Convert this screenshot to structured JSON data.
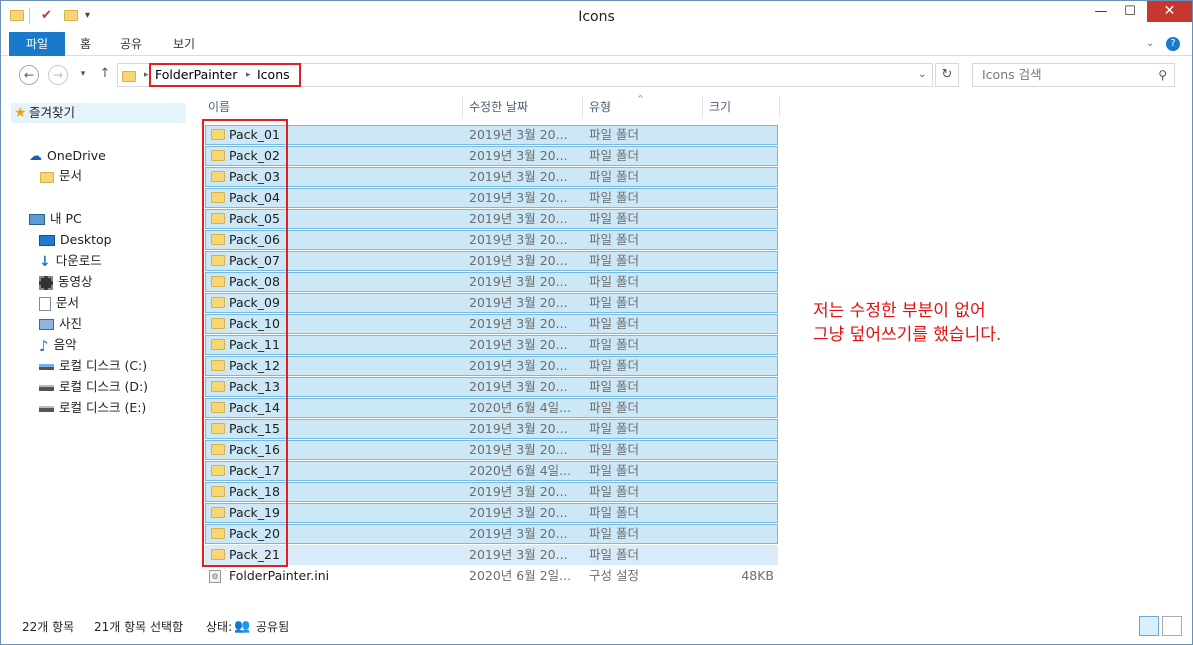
{
  "window": {
    "title": "Icons",
    "minimize": "—",
    "maximize": "☐",
    "close": "✕"
  },
  "ribbon": {
    "tabs": [
      "파일",
      "홈",
      "공유",
      "보기"
    ]
  },
  "address": {
    "crumbs": [
      "FolderPainter",
      "Icons"
    ],
    "search_placeholder": "Icons 검색"
  },
  "nav": {
    "favorites": "즐겨찾기",
    "onedrive": "OneDrive",
    "onedrive_docs": "문서",
    "pc": "내 PC",
    "desktop": "Desktop",
    "downloads": "다운로드",
    "videos": "동영상",
    "documents": "문서",
    "pictures": "사진",
    "music": "음악",
    "drive_c": "로컬 디스크 (C:)",
    "drive_d": "로컬 디스크 (D:)",
    "drive_e": "로컬 디스크 (E:)"
  },
  "columns": {
    "name": "이름",
    "date": "수정한 날짜",
    "type": "유형",
    "size": "크기"
  },
  "files": [
    {
      "name": "Pack_01",
      "date": "2019년 3월 20...",
      "type": "파일 폴더",
      "size": ""
    },
    {
      "name": "Pack_02",
      "date": "2019년 3월 20...",
      "type": "파일 폴더",
      "size": ""
    },
    {
      "name": "Pack_03",
      "date": "2019년 3월 20...",
      "type": "파일 폴더",
      "size": ""
    },
    {
      "name": "Pack_04",
      "date": "2019년 3월 20...",
      "type": "파일 폴더",
      "size": ""
    },
    {
      "name": "Pack_05",
      "date": "2019년 3월 20...",
      "type": "파일 폴더",
      "size": ""
    },
    {
      "name": "Pack_06",
      "date": "2019년 3월 20...",
      "type": "파일 폴더",
      "size": ""
    },
    {
      "name": "Pack_07",
      "date": "2019년 3월 20...",
      "type": "파일 폴더",
      "size": ""
    },
    {
      "name": "Pack_08",
      "date": "2019년 3월 20...",
      "type": "파일 폴더",
      "size": ""
    },
    {
      "name": "Pack_09",
      "date": "2019년 3월 20...",
      "type": "파일 폴더",
      "size": ""
    },
    {
      "name": "Pack_10",
      "date": "2019년 3월 20...",
      "type": "파일 폴더",
      "size": ""
    },
    {
      "name": "Pack_11",
      "date": "2019년 3월 20...",
      "type": "파일 폴더",
      "size": ""
    },
    {
      "name": "Pack_12",
      "date": "2019년 3월 20...",
      "type": "파일 폴더",
      "size": ""
    },
    {
      "name": "Pack_13",
      "date": "2019년 3월 20...",
      "type": "파일 폴더",
      "size": ""
    },
    {
      "name": "Pack_14",
      "date": "2020년 6월 4일...",
      "type": "파일 폴더",
      "size": ""
    },
    {
      "name": "Pack_15",
      "date": "2019년 3월 20...",
      "type": "파일 폴더",
      "size": ""
    },
    {
      "name": "Pack_16",
      "date": "2019년 3월 20...",
      "type": "파일 폴더",
      "size": ""
    },
    {
      "name": "Pack_17",
      "date": "2020년 6월 4일...",
      "type": "파일 폴더",
      "size": ""
    },
    {
      "name": "Pack_18",
      "date": "2019년 3월 20...",
      "type": "파일 폴더",
      "size": ""
    },
    {
      "name": "Pack_19",
      "date": "2019년 3월 20...",
      "type": "파일 폴더",
      "size": ""
    },
    {
      "name": "Pack_20",
      "date": "2019년 3월 20...",
      "type": "파일 폴더",
      "size": ""
    },
    {
      "name": "Pack_21",
      "date": "2019년 3월 20...",
      "type": "파일 폴더",
      "size": ""
    },
    {
      "name": "FolderPainter.ini",
      "date": "2020년 6월 2일...",
      "type": "구성 설정",
      "size": "48KB"
    }
  ],
  "annotation": {
    "line1": "저는 수정한 부분이 없어",
    "line2": "그냥 덮어쓰기를 했습니다."
  },
  "status": {
    "count": "22개 항목",
    "selected": "21개 항목 선택함",
    "state_label": "상태:",
    "state_value": "공유됨"
  },
  "colors": {
    "accent": "#1979ca",
    "selection": "#cce8f7",
    "highlight_box": "#e02020"
  }
}
